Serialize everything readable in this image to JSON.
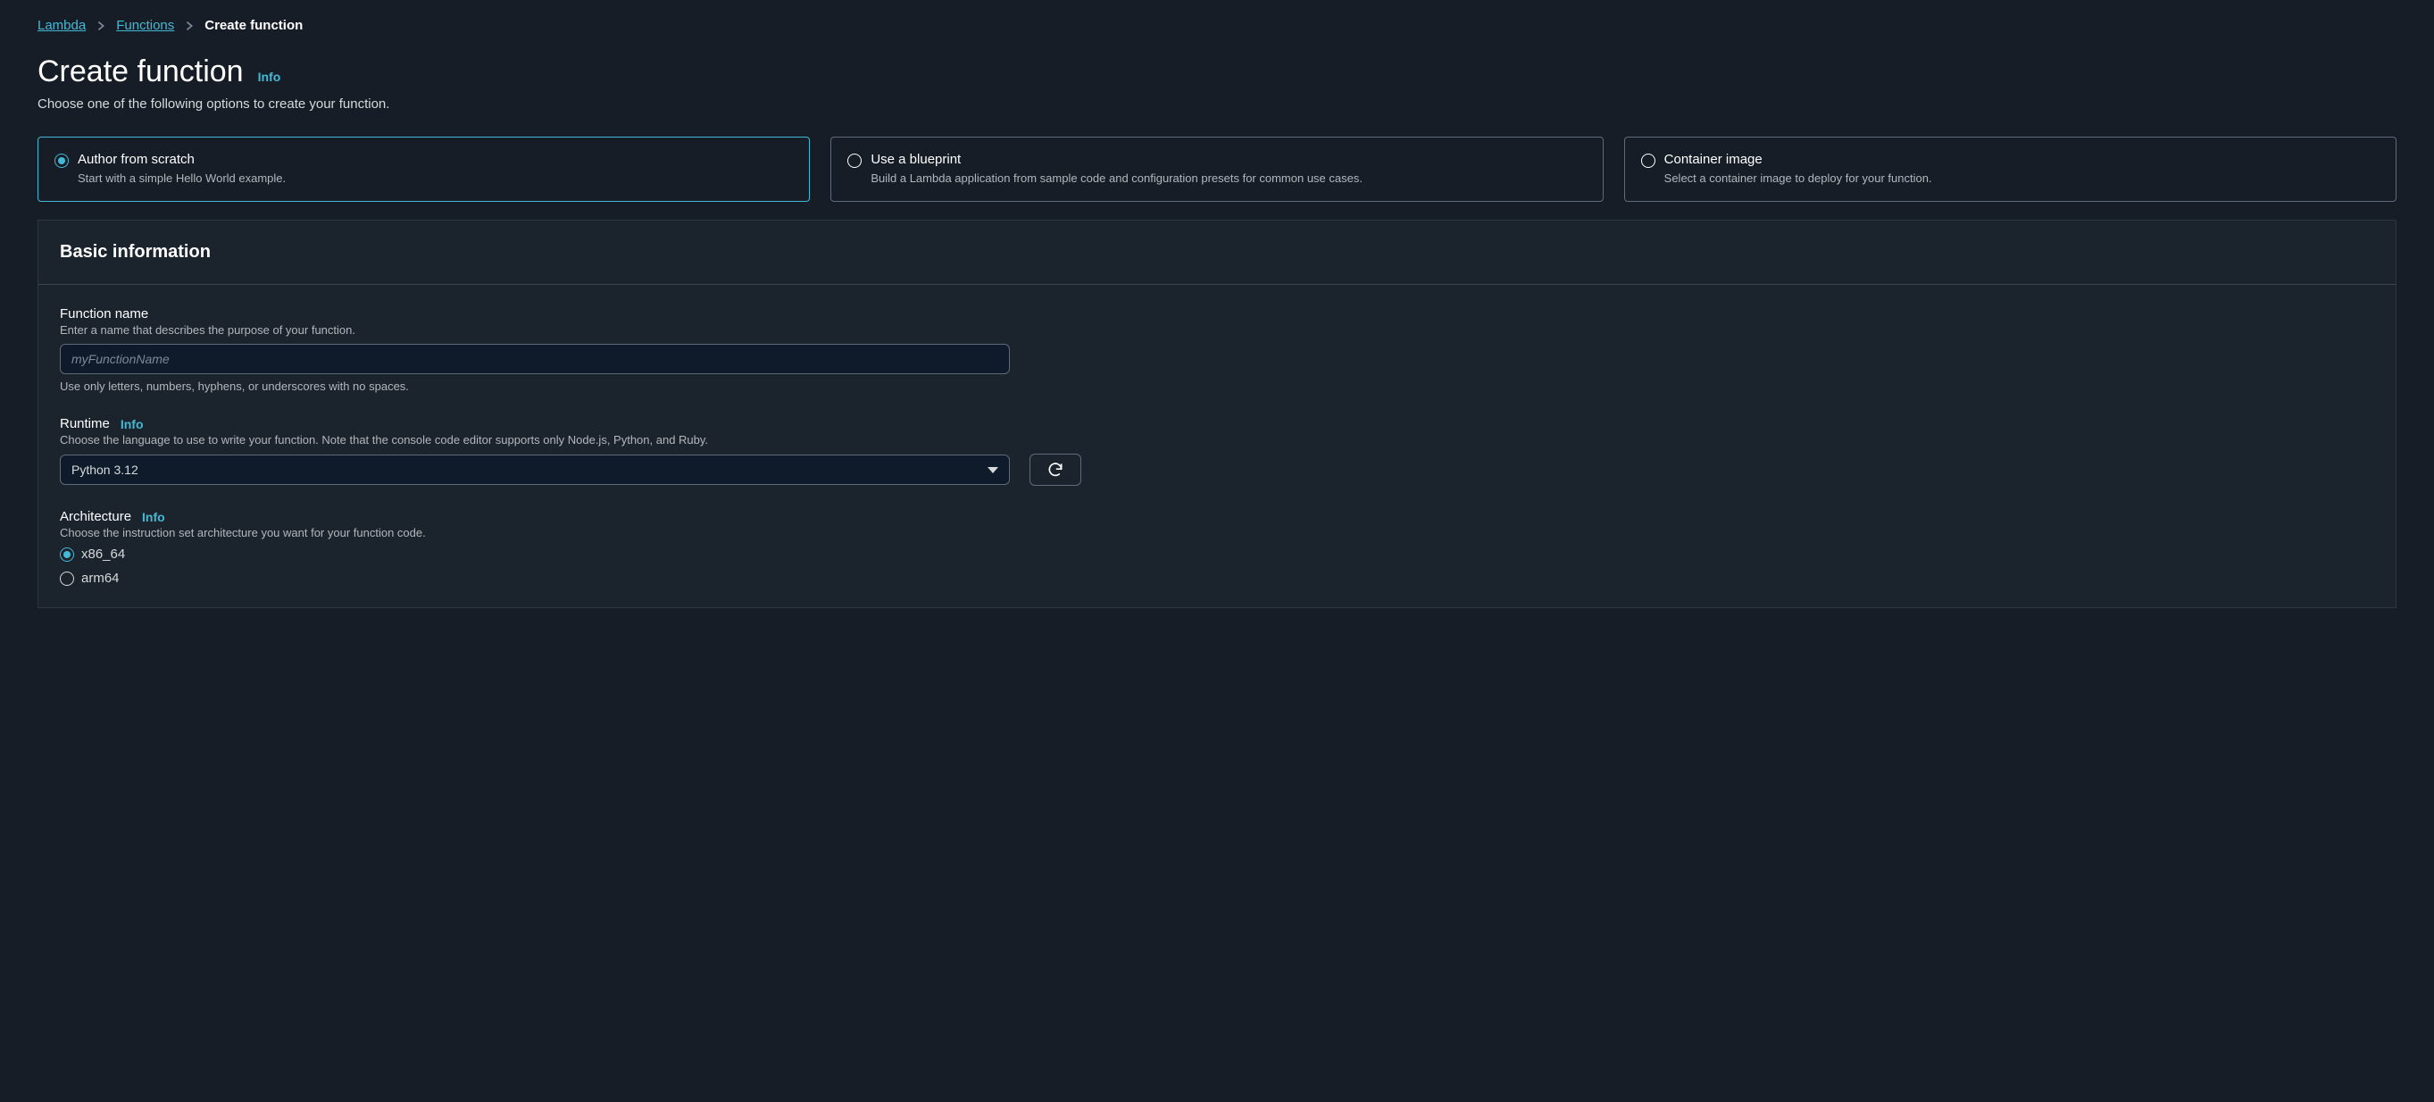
{
  "breadcrumb": {
    "items": [
      "Lambda",
      "Functions"
    ],
    "current": "Create function"
  },
  "page": {
    "title": "Create function",
    "info_label": "Info",
    "subtitle": "Choose one of the following options to create your function."
  },
  "options": [
    {
      "title": "Author from scratch",
      "desc": "Start with a simple Hello World example.",
      "selected": true
    },
    {
      "title": "Use a blueprint",
      "desc": "Build a Lambda application from sample code and configuration presets for common use cases.",
      "selected": false
    },
    {
      "title": "Container image",
      "desc": "Select a container image to deploy for your function.",
      "selected": false
    }
  ],
  "panel": {
    "title": "Basic information"
  },
  "fields": {
    "function_name": {
      "label": "Function name",
      "desc": "Enter a name that describes the purpose of your function.",
      "placeholder": "myFunctionName",
      "value": "",
      "hint": "Use only letters, numbers, hyphens, or underscores with no spaces."
    },
    "runtime": {
      "label": "Runtime",
      "info": "Info",
      "desc": "Choose the language to use to write your function. Note that the console code editor supports only Node.js, Python, and Ruby.",
      "value": "Python 3.12"
    },
    "architecture": {
      "label": "Architecture",
      "info": "Info",
      "desc": "Choose the instruction set architecture you want for your function code.",
      "options": [
        {
          "label": "x86_64",
          "selected": true
        },
        {
          "label": "arm64",
          "selected": false
        }
      ]
    }
  }
}
